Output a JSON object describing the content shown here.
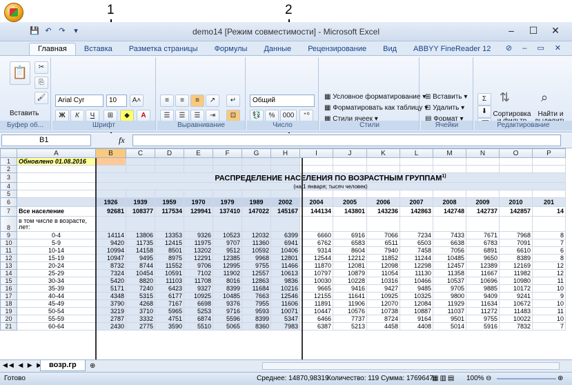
{
  "annotation": {
    "label1": "1",
    "label2": "2"
  },
  "window": {
    "title": "demo14  [Режим совместимости] - Microsoft Excel",
    "min": "–",
    "restore": "☐",
    "close": "✕"
  },
  "tabs": [
    "Главная",
    "Вставка",
    "Разметка страницы",
    "Формулы",
    "Данные",
    "Рецензирование",
    "Вид",
    "ABBYY FineReader 12"
  ],
  "ribbon": {
    "clipboard": {
      "paste": "Вставить",
      "label": "Буфер об..."
    },
    "font": {
      "name": "Arial Cyr",
      "size": "10",
      "bold": "Ж",
      "italic": "К",
      "underline": "Ч",
      "label": "Шрифт"
    },
    "align": {
      "label": "Выравнивание"
    },
    "number": {
      "format": "Общий",
      "percent": "%",
      "thousands": "000",
      "label": "Число"
    },
    "styles": {
      "cond": "Условное форматирование",
      "table": "Форматировать как таблицу",
      "cell": "Стили ячеек",
      "label": "Стили"
    },
    "cells": {
      "insert": "Вставить",
      "delete": "Удалить",
      "format": "Формат",
      "label": "Ячейки"
    },
    "editing": {
      "sort": "Сортировка и фильтр",
      "find": "Найти и выделить",
      "label": "Редактирование"
    }
  },
  "formula": {
    "cell": "B1",
    "fx": "fx",
    "value": ""
  },
  "columns": [
    "",
    "A",
    "B",
    "C",
    "D",
    "E",
    "F",
    "G",
    "H",
    "I",
    "J",
    "K",
    "L",
    "M",
    "N",
    "O",
    "P"
  ],
  "sheet": {
    "r1a": "Обновлено 01.08.2016",
    "title": "РАСПРЕДЕЛЕНИЕ НАСЕЛЕНИЯ ПО ВОЗРАСТНЫМ ГРУППАМ",
    "title_sup": "1)",
    "subtitle": "(на 1 января; тысяч человек)",
    "years": [
      "1926",
      "1939",
      "1959",
      "1970",
      "1979",
      "1989",
      "2002",
      "2004",
      "2005",
      "2006",
      "2007",
      "2008",
      "2009",
      "2010",
      "201"
    ],
    "r7": {
      "label": "Все население",
      "values": [
        "92681",
        "108377",
        "117534",
        "129941",
        "137410",
        "147022",
        "145167",
        "144134",
        "143801",
        "143236",
        "142863",
        "142748",
        "142737",
        "142857",
        "14"
      ]
    },
    "r8a": "в том числе в возрасте,",
    "r8b": "лет:",
    "rows": [
      {
        "n": "9",
        "a": "0-4",
        "v": [
          "14114",
          "13806",
          "13353",
          "9326",
          "10523",
          "12032",
          "6399",
          "6660",
          "6916",
          "7066",
          "7234",
          "7433",
          "7671",
          "7968",
          "8"
        ]
      },
      {
        "n": "10",
        "a": "5-9",
        "v": [
          "9420",
          "11735",
          "12415",
          "11975",
          "9707",
          "11360",
          "6941",
          "6762",
          "6583",
          "6511",
          "6503",
          "6638",
          "6783",
          "7091",
          "7"
        ]
      },
      {
        "n": "11",
        "a": "10-14",
        "v": [
          "10994",
          "14158",
          "8501",
          "13202",
          "9512",
          "10592",
          "10406",
          "9314",
          "8604",
          "7940",
          "7458",
          "7056",
          "6891",
          "6610",
          "6"
        ]
      },
      {
        "n": "12",
        "a": "15-19",
        "v": [
          "10947",
          "9495",
          "8975",
          "12291",
          "12385",
          "9968",
          "12801",
          "12544",
          "12212",
          "11852",
          "11244",
          "10485",
          "9650",
          "8389",
          "8"
        ]
      },
      {
        "n": "13",
        "a": "20-24",
        "v": [
          "8732",
          "8744",
          "11552",
          "9706",
          "12995",
          "9755",
          "11466",
          "11870",
          "12081",
          "12098",
          "12298",
          "12457",
          "12389",
          "12169",
          "12"
        ]
      },
      {
        "n": "14",
        "a": "25-29",
        "v": [
          "7324",
          "10454",
          "10591",
          "7102",
          "11902",
          "12557",
          "10613",
          "10797",
          "10879",
          "11054",
          "11130",
          "11358",
          "11667",
          "11982",
          "12"
        ]
      },
      {
        "n": "15",
        "a": "30-34",
        "v": [
          "5420",
          "8820",
          "11103",
          "11708",
          "8016",
          "12863",
          "9836",
          "10030",
          "10228",
          "10316",
          "10466",
          "10537",
          "10696",
          "10980",
          "11"
        ]
      },
      {
        "n": "16",
        "a": "35-39",
        "v": [
          "5171",
          "7240",
          "6423",
          "9327",
          "8399",
          "11684",
          "10216",
          "9665",
          "9416",
          "9427",
          "9485",
          "9705",
          "9885",
          "10172",
          "10"
        ]
      },
      {
        "n": "17",
        "a": "40-44",
        "v": [
          "4348",
          "5315",
          "6177",
          "10925",
          "10485",
          "7663",
          "12546",
          "12155",
          "11641",
          "10925",
          "10325",
          "9800",
          "9409",
          "9241",
          "9"
        ]
      },
      {
        "n": "18",
        "a": "45-49",
        "v": [
          "3790",
          "4268",
          "7167",
          "6698",
          "9376",
          "7955",
          "11606",
          "11891",
          "11906",
          "12070",
          "12084",
          "11929",
          "11634",
          "10672",
          "10"
        ]
      },
      {
        "n": "19",
        "a": "50-54",
        "v": [
          "3219",
          "3710",
          "5965",
          "5253",
          "9716",
          "9593",
          "10071",
          "10447",
          "10576",
          "10738",
          "10887",
          "11037",
          "11272",
          "11483",
          "11"
        ]
      },
      {
        "n": "20",
        "a": "55-59",
        "v": [
          "2787",
          "3332",
          "4751",
          "6874",
          "5596",
          "8399",
          "5347",
          "6466",
          "7737",
          "8724",
          "9164",
          "9501",
          "9755",
          "10022",
          "10"
        ]
      },
      {
        "n": "21",
        "a": "60-64",
        "v": [
          "2430",
          "2775",
          "3590",
          "5510",
          "5065",
          "8360",
          "7983",
          "6387",
          "5213",
          "4458",
          "4408",
          "5014",
          "5916",
          "7832",
          "7"
        ]
      }
    ]
  },
  "sheettab": "возр.гр",
  "status": {
    "ready": "Готово",
    "avg": "Среднее: 14870,98319",
    "count": "Количество: 119",
    "sum": "Сумма: 1769647",
    "zoom": "100%"
  }
}
